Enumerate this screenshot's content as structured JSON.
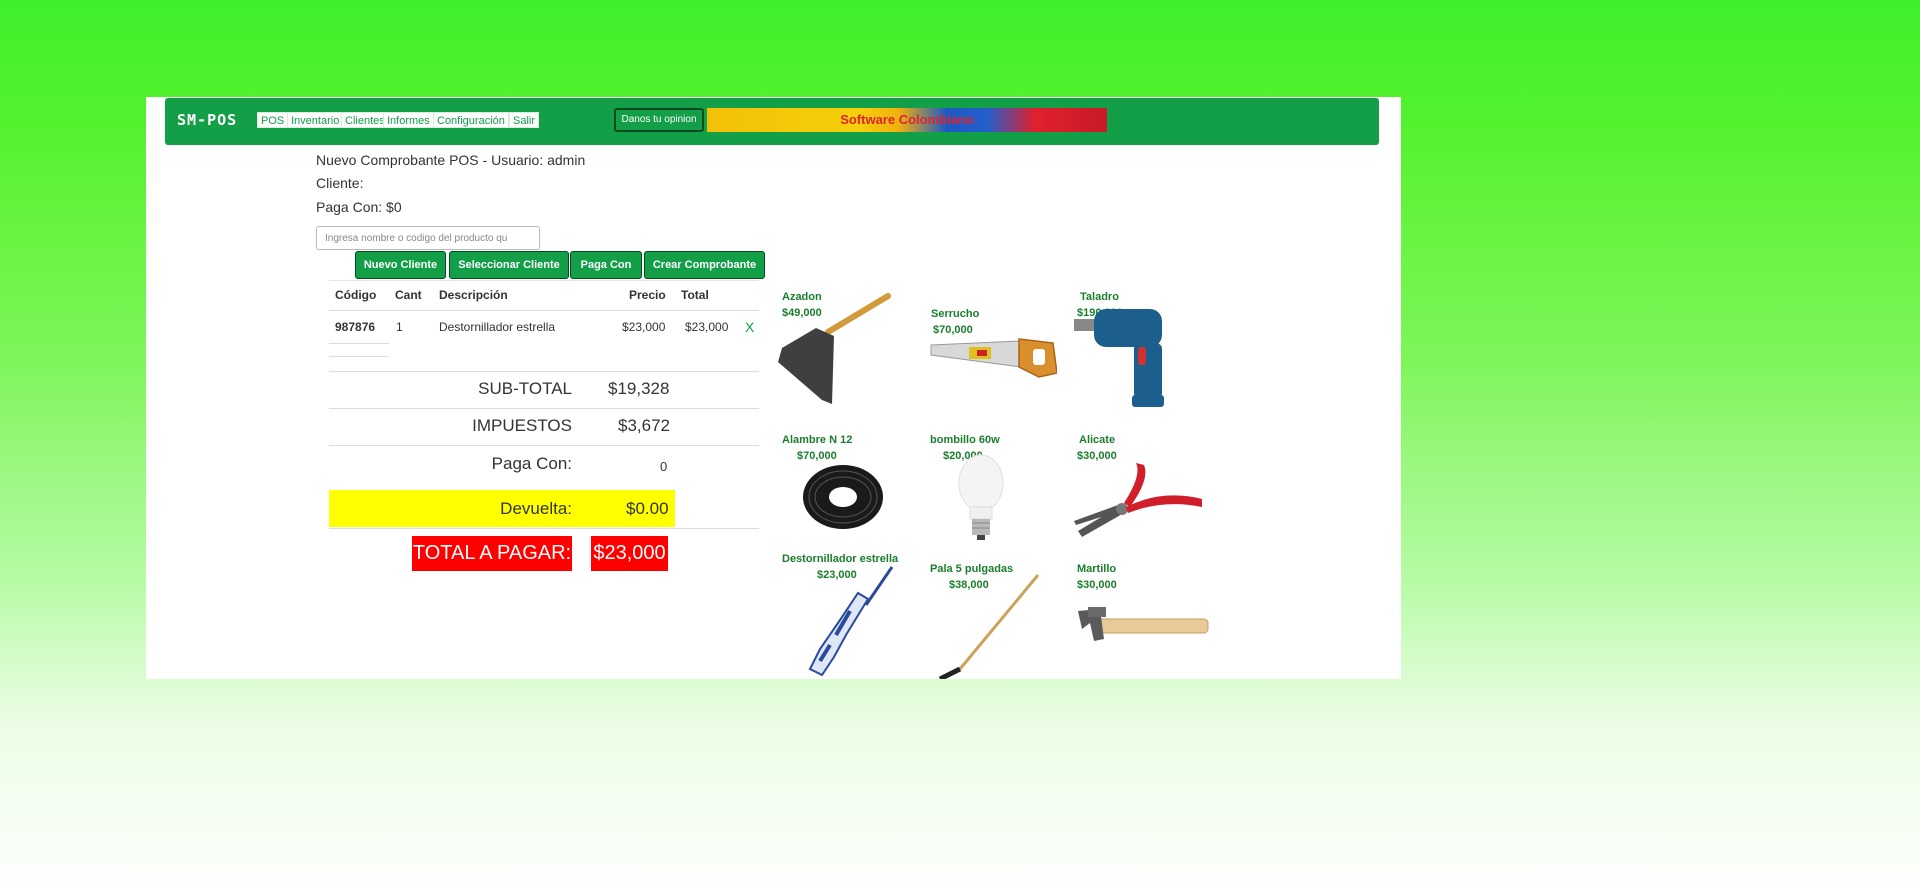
{
  "app": {
    "brand": "SM-POS",
    "nav": [
      "POS",
      "Inventario",
      "Clientes",
      "Informes",
      "Configuración",
      "Salir"
    ],
    "feedback_label": "Danos tu opinion",
    "banner_text": "Software Colombiano"
  },
  "header": {
    "title": "Nuevo Comprobante POS - Usuario: admin",
    "client": "Cliente:",
    "pays_with": "Paga Con: $0"
  },
  "search": {
    "placeholder": "Ingresa nombre o codigo del producto qu"
  },
  "actions": {
    "new_client": "Nuevo Cliente",
    "select_client": "Seleccionar Cliente",
    "pays_with": "Paga Con",
    "create_receipt": "Crear Comprobante"
  },
  "table": {
    "headers": {
      "code": "Código",
      "qty": "Cant",
      "desc": "Descripción",
      "price": "Precio",
      "total": "Total"
    },
    "rows": [
      {
        "code": "987876",
        "qty": "1",
        "desc": "Destornillador estrella",
        "price": "$23,000",
        "total": "$23,000",
        "remove": "X"
      }
    ]
  },
  "totals": {
    "subtotal_label": "SUB-TOTAL",
    "subtotal": "$19,328",
    "tax_label": "IMPUESTOS",
    "tax": "$3,672",
    "paid_label": "Paga Con:",
    "paid": "0",
    "change_label": "Devuelta:",
    "change": "$0.00",
    "total_label": "TOTAL A PAGAR:",
    "total": "$23,000"
  },
  "products": [
    {
      "name": "Azadon",
      "price": "$49,000",
      "icon": "hoe-icon"
    },
    {
      "name": "Serrucho",
      "price": "$70,000",
      "icon": "saw-icon"
    },
    {
      "name": "Taladro",
      "price": "$190,000",
      "icon": "drill-icon"
    },
    {
      "name": "Alambre N 12",
      "price": "$70,000",
      "icon": "wire-coil-icon"
    },
    {
      "name": "bombillo 60w",
      "price": "$20,000",
      "icon": "light-bulb-icon"
    },
    {
      "name": "Alicate",
      "price": "$30,000",
      "icon": "pliers-icon"
    },
    {
      "name": "Destornillador estrella",
      "price": "$23,000",
      "icon": "screwdriver-icon"
    },
    {
      "name": "Pala 5 pulgadas",
      "price": "$38,000",
      "icon": "shovel-icon"
    },
    {
      "name": "Martillo",
      "price": "$30,000",
      "icon": "hammer-icon"
    }
  ],
  "colors": {
    "accent": "#129f48",
    "change_bg": "#ffff00",
    "total_bg": "#ff0000",
    "product_text": "#1a7e2c"
  }
}
